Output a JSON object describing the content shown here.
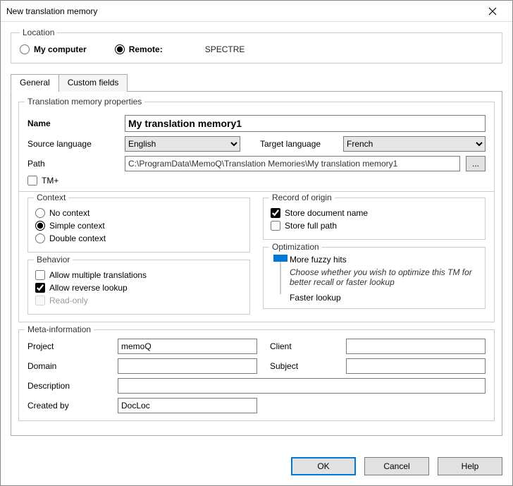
{
  "window": {
    "title": "New translation memory"
  },
  "location": {
    "legend": "Location",
    "my_computer": "My computer",
    "remote": "Remote:",
    "remote_name": "SPECTRE",
    "selected": "remote"
  },
  "tabs": {
    "general": "General",
    "custom": "Custom fields"
  },
  "props": {
    "legend": "Translation memory properties",
    "name_label": "Name",
    "name_value": "My translation memory1",
    "source_label": "Source language",
    "source_value": "English",
    "target_label": "Target language",
    "target_value": "French",
    "path_label": "Path",
    "path_value": "C:\\ProgramData\\MemoQ\\Translation Memories\\My translation memory1",
    "tm_plus": "TM+"
  },
  "context": {
    "legend": "Context",
    "none": "No context",
    "simple": "Simple context",
    "double": "Double context"
  },
  "behavior": {
    "legend": "Behavior",
    "allow_multi": "Allow multiple translations",
    "allow_reverse": "Allow reverse lookup",
    "read_only": "Read-only"
  },
  "record": {
    "legend": "Record of origin",
    "store_doc": "Store document name",
    "store_path": "Store full path"
  },
  "optim": {
    "legend": "Optimization",
    "more_fuzzy": "More fuzzy hits",
    "desc": "Choose whether you wish to optimize this TM for better recall or faster lookup",
    "faster": "Faster lookup"
  },
  "meta": {
    "legend": "Meta-information",
    "project_label": "Project",
    "project_value": "memoQ",
    "client_label": "Client",
    "client_value": "",
    "domain_label": "Domain",
    "domain_value": "",
    "subject_label": "Subject",
    "subject_value": "",
    "description_label": "Description",
    "description_value": "",
    "created_by_label": "Created by",
    "created_by_value": "DocLoc"
  },
  "buttons": {
    "ok": "OK",
    "cancel": "Cancel",
    "help": "Help"
  }
}
